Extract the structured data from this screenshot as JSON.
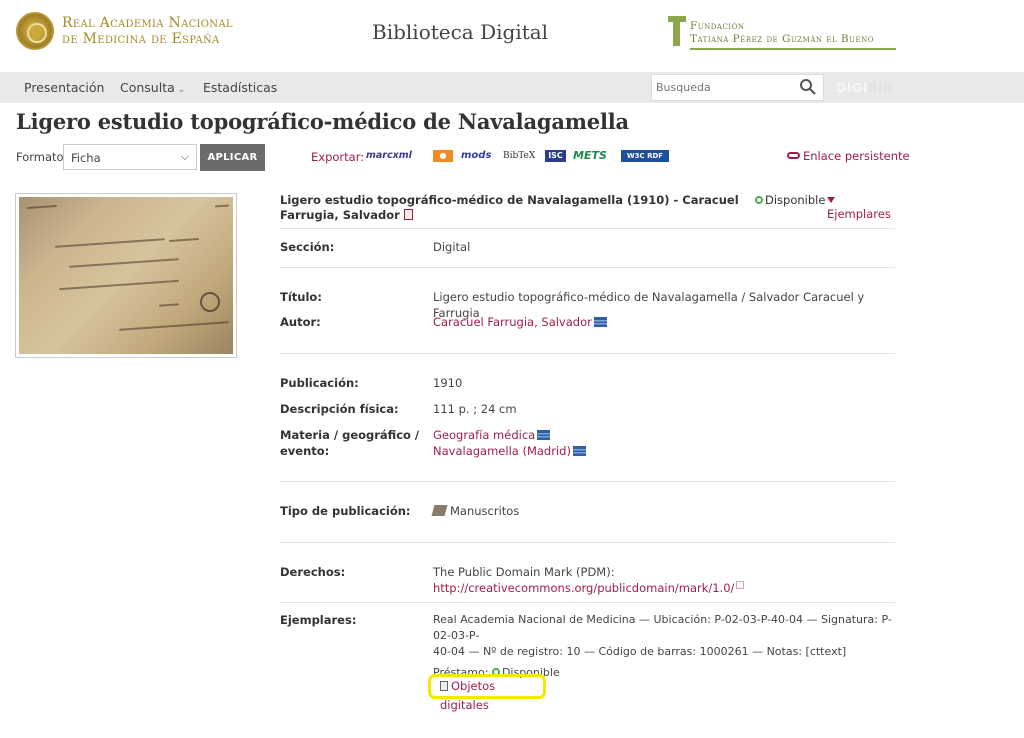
{
  "header": {
    "ranm_line1": "Real Academia Nacional",
    "ranm_line2": "de Medicina de España",
    "site_title": "Biblioteca Digital",
    "fund_line1": "Fundación",
    "fund_line2": "Tatiana Pérez de Guzmán el Bueno"
  },
  "nav": {
    "items": [
      "Presentación",
      "Consulta",
      "Estadísticas"
    ],
    "search_placeholder": "Busqueda",
    "digibib_a": "DIGI",
    "digibib_b": "BIB"
  },
  "page_title": "Ligero estudio topográfico-médico de Navalagamella",
  "toolbar": {
    "formato_label": "Formato:",
    "formato_value": "Ficha",
    "aplicar_label": "APLICAR",
    "exportar_label": "Exportar:",
    "export_formats": [
      "marcxml",
      "rss",
      "mods",
      "BibTeX",
      "ISC",
      "METS",
      "W3C RDF"
    ],
    "enlace_label": "Enlace persistente"
  },
  "record": {
    "heading": "Ligero estudio topográfico-médico de Navalagamella (1910) - Caracuel Farrugia, Salvador",
    "status": "Disponible",
    "ejemplares_link": "Ejemplares",
    "fields": {
      "seccion_label": "Sección:",
      "seccion_value": "Digital",
      "titulo_label": "Título:",
      "titulo_value": "Ligero estudio topográfico-médico de Navalagamella / Salvador Caracuel y Farrugia",
      "autor_label": "Autor:",
      "autor_value": "Caracuel Farrugia, Salvador",
      "publicacion_label": "Publicación:",
      "publicacion_value": "1910",
      "descripcion_label": "Descripción física:",
      "descripcion_value": "111 p. ; 24 cm",
      "materia_label_1": "Materia / geográfico /",
      "materia_label_2": "evento:",
      "materia_value_1": "Geografía médica",
      "materia_value_2": "Navalagamella (Madrid)",
      "tipo_label": "Tipo de publicación:",
      "tipo_value": "Manuscritos",
      "derechos_label": "Derechos:",
      "derechos_text": "The Public Domain Mark (PDM): ",
      "derechos_link": "http://creativecommons.org/publicdomain/mark/1.0/",
      "ejemplares_label": "Ejemplares:",
      "ejemplares_line1": "Real Academia Nacional de Medicina — Ubicación: P-02-03-P-40-04 — Signatura: P-02-03-P-",
      "ejemplares_line2": "40-04 — Nº de registro: 10 — Código de barras: 1000261 — Notas: [cttext]",
      "prestamo_label": "Préstamo:",
      "prestamo_value": "Disponible",
      "objetos_label": "Objetos digitales"
    }
  },
  "colors": {
    "link": "#a01d4a",
    "nav_bg": "#e9e9e9",
    "highlight": "#f5e800",
    "available": "#4caf50"
  }
}
